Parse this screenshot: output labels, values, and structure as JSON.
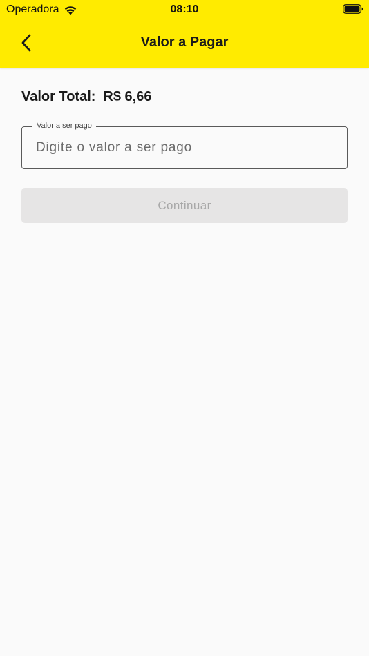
{
  "status_bar": {
    "carrier": "Operadora",
    "time": "08:10",
    "wifi_icon": "wifi-icon",
    "battery_icon": "battery-icon"
  },
  "header": {
    "title": "Valor a Pagar",
    "back_icon": "chevron-left-icon",
    "background_color": "#ffeb00"
  },
  "summary": {
    "total_label": "Valor Total:",
    "total_value": "R$ 6,66"
  },
  "amount_field": {
    "label": "Valor a ser pago",
    "placeholder": "Digite o valor a ser pago",
    "value": ""
  },
  "continue_button": {
    "label": "Continuar",
    "state": "disabled"
  }
}
